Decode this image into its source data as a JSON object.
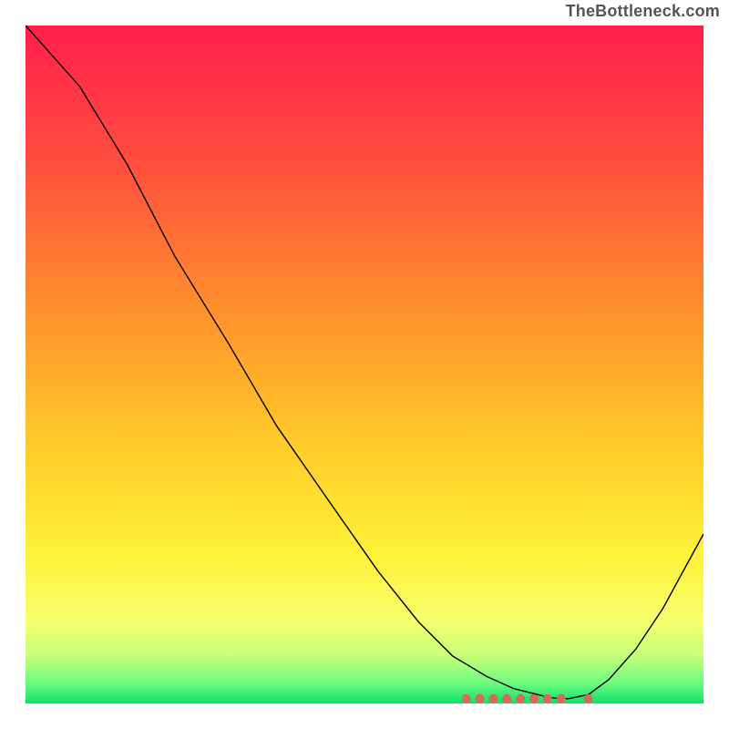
{
  "attribution": "TheBottleneck.com",
  "chart_data": {
    "type": "line",
    "title": "",
    "xlabel": "",
    "ylabel": "",
    "grid": false,
    "legend": false,
    "xlim": [
      0,
      100
    ],
    "ylim": [
      0,
      100
    ],
    "axes_visible": false,
    "series": [
      {
        "name": "curve",
        "x": [
          0,
          8,
          15,
          22,
          30,
          37,
          45,
          52,
          58,
          63,
          68,
          72,
          76,
          78,
          80,
          83,
          86,
          90,
          94,
          97,
          100
        ],
        "y": [
          100.0,
          91.0,
          79.5,
          66.0,
          53.0,
          41.0,
          29.5,
          19.5,
          12.0,
          7.0,
          4.0,
          2.2,
          1.2,
          0.8,
          0.7,
          1.3,
          3.5,
          8.0,
          14.0,
          19.5,
          25.0
        ]
      }
    ],
    "markers": {
      "name": "bottom-cluster",
      "points": [
        {
          "x": 65,
          "y": 0.7
        },
        {
          "x": 67,
          "y": 0.7
        },
        {
          "x": 69,
          "y": 0.7
        },
        {
          "x": 71,
          "y": 0.7
        },
        {
          "x": 73,
          "y": 0.7
        },
        {
          "x": 75,
          "y": 0.7
        },
        {
          "x": 77,
          "y": 0.7
        },
        {
          "x": 79,
          "y": 0.7
        },
        {
          "x": 83,
          "y": 0.7
        }
      ]
    },
    "gradient_stops": [
      {
        "offset": 0.0,
        "color": "#ff1f4b"
      },
      {
        "offset": 0.2,
        "color": "#ff4d3f"
      },
      {
        "offset": 0.4,
        "color": "#ff8a2e"
      },
      {
        "offset": 0.6,
        "color": "#ffc728"
      },
      {
        "offset": 0.78,
        "color": "#fff23a"
      },
      {
        "offset": 0.88,
        "color": "#f6ff6e"
      },
      {
        "offset": 0.93,
        "color": "#c6ff7a"
      },
      {
        "offset": 0.97,
        "color": "#6cfb7e"
      },
      {
        "offset": 1.0,
        "color": "#11e06b"
      }
    ]
  }
}
